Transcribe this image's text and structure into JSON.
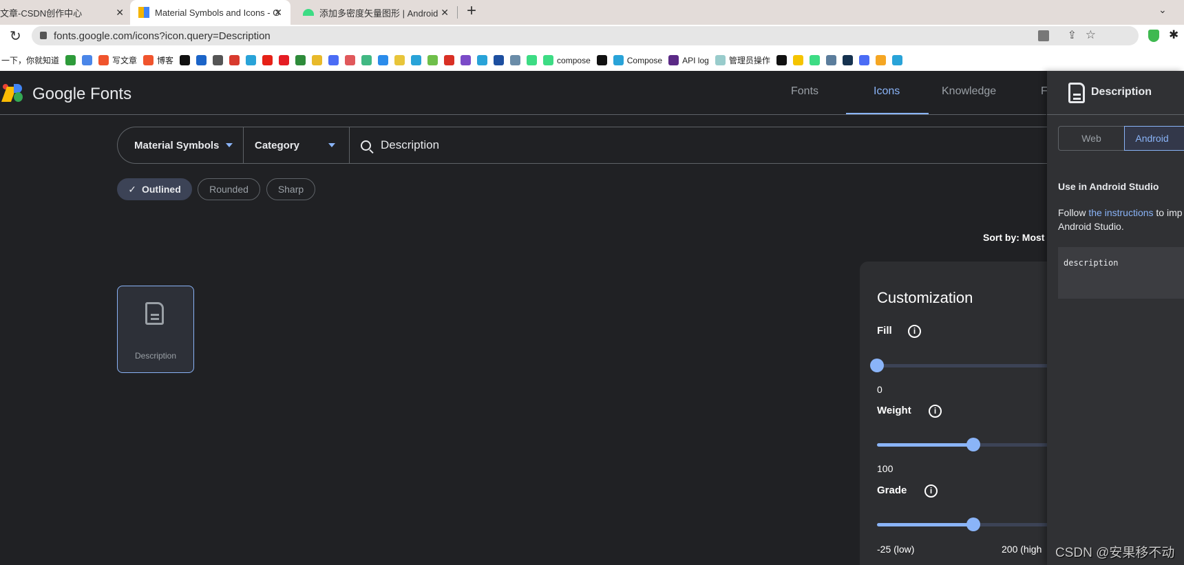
{
  "browser": {
    "tabs": [
      {
        "title": "文章-CSDN创作中心",
        "active": false
      },
      {
        "title": "Material Symbols and Icons - G",
        "active": true
      },
      {
        "title": "添加多密度矢量图形 | Android",
        "active": false
      }
    ],
    "url": "fonts.google.com/icons?icon.query=Description",
    "bookmarks": [
      {
        "label": "一下，你就知道",
        "color": "#ffffff"
      },
      {
        "label": "",
        "color": "#2e9b3a"
      },
      {
        "label": "",
        "color": "#4a86e8"
      },
      {
        "label": "写文章",
        "color": "#f0542d"
      },
      {
        "label": "博客",
        "color": "#f0542d"
      },
      {
        "label": "",
        "color": "#111111"
      },
      {
        "label": "",
        "color": "#1b64c8"
      },
      {
        "label": "",
        "color": "#555555"
      },
      {
        "label": "",
        "color": "#d83a2e"
      },
      {
        "label": "",
        "color": "#29a3d8"
      },
      {
        "label": "",
        "color": "#e62117"
      },
      {
        "label": "",
        "color": "#e51d24"
      },
      {
        "label": "",
        "color": "#2e8b3a"
      },
      {
        "label": "",
        "color": "#e8b92a"
      },
      {
        "label": "",
        "color": "#4b6cf5"
      },
      {
        "label": "",
        "color": "#e0585b"
      },
      {
        "label": "",
        "color": "#41b883"
      },
      {
        "label": "",
        "color": "#2b8ceb"
      },
      {
        "label": "",
        "color": "#e8c53a"
      },
      {
        "label": "",
        "color": "#29a3d8"
      },
      {
        "label": "",
        "color": "#6fbf4a"
      },
      {
        "label": "",
        "color": "#d93025"
      },
      {
        "label": "",
        "color": "#7b4bc8"
      },
      {
        "label": "",
        "color": "#29a3d8"
      },
      {
        "label": "",
        "color": "#1d4fa0"
      },
      {
        "label": "",
        "color": "#6a8ca8"
      },
      {
        "label": "",
        "color": "#3ddc84"
      },
      {
        "label": "compose",
        "color": "#3ddc84"
      },
      {
        "label": "",
        "color": "#111111"
      },
      {
        "label": "Compose",
        "color": "#29a3d8"
      },
      {
        "label": "API log",
        "color": "#5b2a86"
      },
      {
        "label": "管理员操作",
        "color": "#9cc"
      },
      {
        "label": "",
        "color": "#111111"
      },
      {
        "label": "",
        "color": "#f5c400"
      },
      {
        "label": "",
        "color": "#3ddc84"
      },
      {
        "label": "",
        "color": "#5b7d9c"
      },
      {
        "label": "",
        "color": "#16324f"
      },
      {
        "label": "",
        "color": "#4b6cf5"
      },
      {
        "label": "",
        "color": "#f5a623"
      },
      {
        "label": "",
        "color": "#29a3d8"
      }
    ]
  },
  "header": {
    "brand": "Google Fonts",
    "nav": [
      {
        "label": "Fonts"
      },
      {
        "label": "Icons",
        "active": true
      },
      {
        "label": "Knowledge"
      },
      {
        "label": "F"
      }
    ]
  },
  "search": {
    "family": "Material Symbols",
    "category": "Category",
    "query": "Description"
  },
  "styles": [
    {
      "label": "Outlined",
      "selected": true
    },
    {
      "label": "Rounded"
    },
    {
      "label": "Sharp"
    }
  ],
  "sort": {
    "label": "Sort by: Most"
  },
  "results": [
    {
      "name": "Description",
      "icon": "description-icon"
    }
  ],
  "customization": {
    "title": "Customization",
    "fill": {
      "label": "Fill",
      "value": "0",
      "fraction": 0
    },
    "weight": {
      "label": "Weight",
      "value": "100",
      "fraction": 0.5
    },
    "grade": {
      "label": "Grade",
      "min_label": "-25 (low)",
      "max_label": "200 (high",
      "fraction": 0.5
    }
  },
  "panel": {
    "title": "Description",
    "tabs": [
      {
        "label": "Web"
      },
      {
        "label": "Android",
        "active": true
      }
    ],
    "heading": "Use in Android Studio",
    "text_before": "Follow ",
    "link": "the instructions",
    "text_after": " to imp",
    "text_line2": "Android Studio.",
    "code": "description"
  },
  "watermark": "CSDN @安果移不动",
  "colors": {
    "accent": "#8ab4f8",
    "bg": "#202124",
    "panel": "#303134"
  }
}
